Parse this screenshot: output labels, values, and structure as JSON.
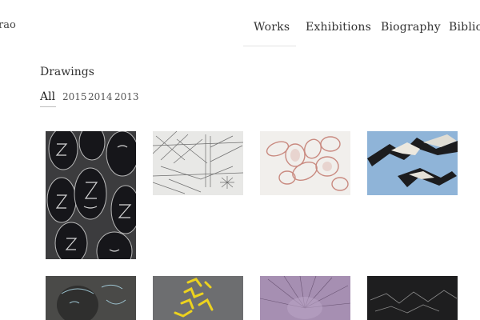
{
  "site": {
    "name": "rao"
  },
  "nav": {
    "items": [
      {
        "label": "Works",
        "active": true
      },
      {
        "label": "Exhibitions"
      },
      {
        "label": "Biography"
      },
      {
        "label": "Bibliog"
      }
    ]
  },
  "section": {
    "title": "Drawings"
  },
  "filters": {
    "items": [
      "All",
      "2015",
      "2014",
      "2013"
    ],
    "active": "All"
  },
  "gallery": {
    "items": [
      {
        "name": "artwork-faces"
      },
      {
        "name": "artwork-line-grid"
      },
      {
        "name": "artwork-pink-loops"
      },
      {
        "name": "artwork-blue-shapes"
      },
      {
        "name": "artwork-dark-figure"
      },
      {
        "name": "artwork-yellow-marks"
      },
      {
        "name": "artwork-violet-burst"
      },
      {
        "name": "artwork-dark-lines"
      }
    ]
  },
  "colors": {
    "text": "#333333",
    "background": "#ffffff",
    "divider": "#e4e4e4"
  }
}
